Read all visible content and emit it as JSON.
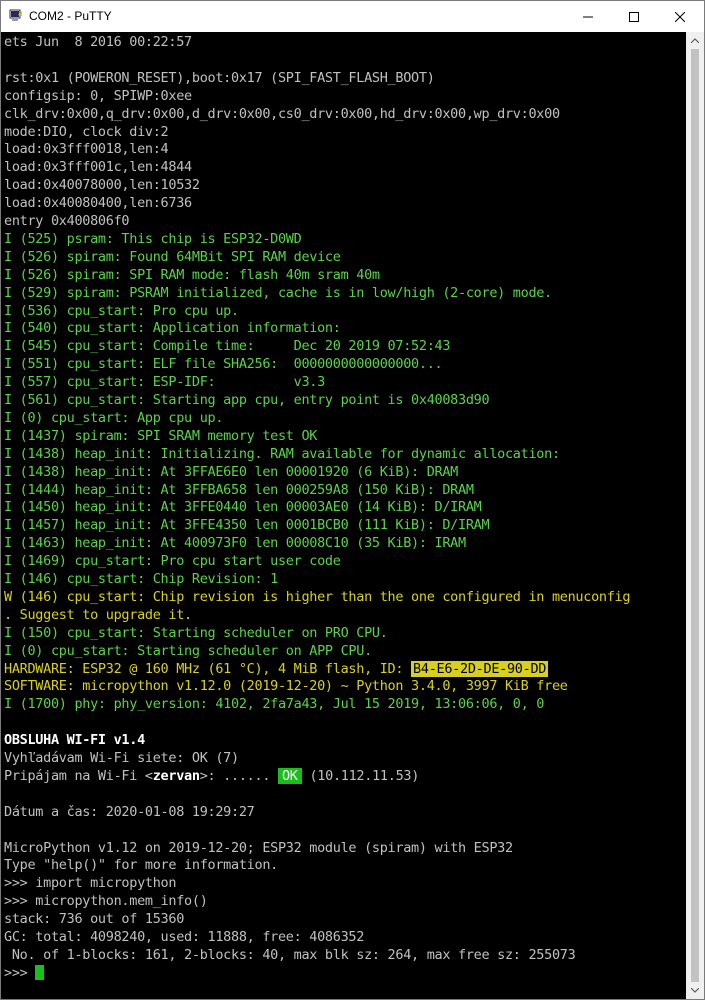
{
  "window": {
    "title": "COM2 - PuTTY",
    "controls": {
      "minimize": "minimize",
      "maximize": "maximize",
      "close": "close"
    }
  },
  "terminal": {
    "lines": [
      {
        "segments": [
          {
            "text": "ets Jun  8 2016 00:22:57",
            "style": "white"
          }
        ]
      },
      {
        "segments": [
          {
            "text": "",
            "style": "white"
          }
        ]
      },
      {
        "segments": [
          {
            "text": "rst:0x1 (POWERON_RESET),boot:0x17 (SPI_FAST_FLASH_BOOT)",
            "style": "white"
          }
        ]
      },
      {
        "segments": [
          {
            "text": "configsip: 0, SPIWP:0xee",
            "style": "white"
          }
        ]
      },
      {
        "segments": [
          {
            "text": "clk_drv:0x00,q_drv:0x00,d_drv:0x00,cs0_drv:0x00,hd_drv:0x00,wp_drv:0x00",
            "style": "white"
          }
        ]
      },
      {
        "segments": [
          {
            "text": "mode:DIO, clock div:2",
            "style": "white"
          }
        ]
      },
      {
        "segments": [
          {
            "text": "load:0x3fff0018,len:4",
            "style": "white"
          }
        ]
      },
      {
        "segments": [
          {
            "text": "load:0x3fff001c,len:4844",
            "style": "white"
          }
        ]
      },
      {
        "segments": [
          {
            "text": "load:0x40078000,len:10532",
            "style": "white"
          }
        ]
      },
      {
        "segments": [
          {
            "text": "load:0x40080400,len:6736",
            "style": "white"
          }
        ]
      },
      {
        "segments": [
          {
            "text": "entry 0x400806f0",
            "style": "white"
          }
        ]
      },
      {
        "segments": [
          {
            "text": "I (525) psram: This chip is ESP32-D0WD",
            "style": "green"
          }
        ]
      },
      {
        "segments": [
          {
            "text": "I (526) spiram: Found 64MBit SPI RAM device",
            "style": "green"
          }
        ]
      },
      {
        "segments": [
          {
            "text": "I (526) spiram: SPI RAM mode: flash 40m sram 40m",
            "style": "green"
          }
        ]
      },
      {
        "segments": [
          {
            "text": "I (529) spiram: PSRAM initialized, cache is in low/high (2-core) mode.",
            "style": "green"
          }
        ]
      },
      {
        "segments": [
          {
            "text": "I (536) cpu_start: Pro cpu up.",
            "style": "green"
          }
        ]
      },
      {
        "segments": [
          {
            "text": "I (540) cpu_start: Application information:",
            "style": "green"
          }
        ]
      },
      {
        "segments": [
          {
            "text": "I (545) cpu_start: Compile time:     Dec 20 2019 07:52:43",
            "style": "green"
          }
        ]
      },
      {
        "segments": [
          {
            "text": "I (551) cpu_start: ELF file SHA256:  0000000000000000...",
            "style": "green"
          }
        ]
      },
      {
        "segments": [
          {
            "text": "I (557) cpu_start: ESP-IDF:          v3.3",
            "style": "green"
          }
        ]
      },
      {
        "segments": [
          {
            "text": "I (561) cpu_start: Starting app cpu, entry point is 0x40083d90",
            "style": "green"
          }
        ]
      },
      {
        "segments": [
          {
            "text": "I (0) cpu_start: App cpu up.",
            "style": "green"
          }
        ]
      },
      {
        "segments": [
          {
            "text": "I (1437) spiram: SPI SRAM memory test OK",
            "style": "green"
          }
        ]
      },
      {
        "segments": [
          {
            "text": "I (1438) heap_init: Initializing. RAM available for dynamic allocation:",
            "style": "green"
          }
        ]
      },
      {
        "segments": [
          {
            "text": "I (1438) heap_init: At 3FFAE6E0 len 00001920 (6 KiB): DRAM",
            "style": "green"
          }
        ]
      },
      {
        "segments": [
          {
            "text": "I (1444) heap_init: At 3FFBA658 len 000259A8 (150 KiB): DRAM",
            "style": "green"
          }
        ]
      },
      {
        "segments": [
          {
            "text": "I (1450) heap_init: At 3FFE0440 len 00003AE0 (14 KiB): D/IRAM",
            "style": "green"
          }
        ]
      },
      {
        "segments": [
          {
            "text": "I (1457) heap_init: At 3FFE4350 len 0001BCB0 (111 KiB): D/IRAM",
            "style": "green"
          }
        ]
      },
      {
        "segments": [
          {
            "text": "I (1463) heap_init: At 400973F0 len 00008C10 (35 KiB): IRAM",
            "style": "green"
          }
        ]
      },
      {
        "segments": [
          {
            "text": "I (1469) cpu_start: Pro cpu start user code",
            "style": "green"
          }
        ]
      },
      {
        "segments": [
          {
            "text": "I (146) cpu_start: Chip Revision: 1",
            "style": "green"
          }
        ]
      },
      {
        "segments": [
          {
            "text": "W (146) cpu_start: Chip revision is higher than the one configured in menuconfig",
            "style": "yellow"
          }
        ]
      },
      {
        "segments": [
          {
            "text": ". Suggest to upgrade it.",
            "style": "yellow"
          }
        ]
      },
      {
        "segments": [
          {
            "text": "I (150) cpu_start: Starting scheduler on PRO CPU.",
            "style": "green"
          }
        ]
      },
      {
        "segments": [
          {
            "text": "I (0) cpu_start: Starting scheduler on APP CPU.",
            "style": "green"
          }
        ]
      },
      {
        "segments": [
          {
            "text": "HARDWARE: ESP32 @ 160 MHz (61 °C), 4 MiB flash, ID: ",
            "style": "yellow"
          },
          {
            "text": "B4-E6-2D-DE-90-DD",
            "style": "hl-yellow"
          }
        ]
      },
      {
        "segments": [
          {
            "text": "SOFTWARE: micropython v1.12.0 (2019-12-20) ~ Python 3.4.0, 3997 KiB free",
            "style": "yellow"
          }
        ]
      },
      {
        "segments": [
          {
            "text": "I (1700) phy: phy_version: 4102, 2fa7a43, Jul 15 2019, 13:06:06, 0, 0",
            "style": "green"
          }
        ]
      },
      {
        "segments": [
          {
            "text": "",
            "style": "white"
          }
        ]
      },
      {
        "segments": [
          {
            "text": "OBSLUHA WI-FI v1.4",
            "style": "bright"
          }
        ]
      },
      {
        "segments": [
          {
            "text": "Vyhľadávam Wi-Fi siete: OK (7)",
            "style": "white"
          }
        ]
      },
      {
        "segments": [
          {
            "text": "Pripájam na Wi-Fi <",
            "style": "white"
          },
          {
            "text": "zervan",
            "style": "bright"
          },
          {
            "text": ">: ...... ",
            "style": "white"
          },
          {
            "text": "OK",
            "style": "hl-green"
          },
          {
            "text": " (10.112.11.53)",
            "style": "white"
          }
        ]
      },
      {
        "segments": [
          {
            "text": "",
            "style": "white"
          }
        ]
      },
      {
        "segments": [
          {
            "text": "Dátum a čas: 2020-01-08 19:29:27",
            "style": "white"
          }
        ]
      },
      {
        "segments": [
          {
            "text": "",
            "style": "white"
          }
        ]
      },
      {
        "segments": [
          {
            "text": "MicroPython v1.12 on 2019-12-20; ESP32 module (spiram) with ESP32",
            "style": "white"
          }
        ]
      },
      {
        "segments": [
          {
            "text": "Type \"help()\" for more information.",
            "style": "white"
          }
        ]
      },
      {
        "segments": [
          {
            "text": ">>> import micropython",
            "style": "white"
          }
        ]
      },
      {
        "segments": [
          {
            "text": ">>> micropython.mem_info()",
            "style": "white"
          }
        ]
      },
      {
        "segments": [
          {
            "text": "stack: 736 out of 15360",
            "style": "white"
          }
        ]
      },
      {
        "segments": [
          {
            "text": "GC: total: 4098240, used: 11888, free: 4086352",
            "style": "white"
          }
        ]
      },
      {
        "segments": [
          {
            "text": " No. of 1-blocks: 161, 2-blocks: 40, max blk sz: 264, max free sz: 255073",
            "style": "white"
          }
        ]
      },
      {
        "segments": [
          {
            "text": ">>> ",
            "style": "white"
          },
          {
            "text": "",
            "style": "cursor"
          }
        ]
      }
    ]
  },
  "colors": {
    "background": "#000000",
    "text_default": "#c0c0c0",
    "text_green": "#5ad24a",
    "text_yellow": "#d8d020",
    "highlight_green": "#19c019"
  }
}
